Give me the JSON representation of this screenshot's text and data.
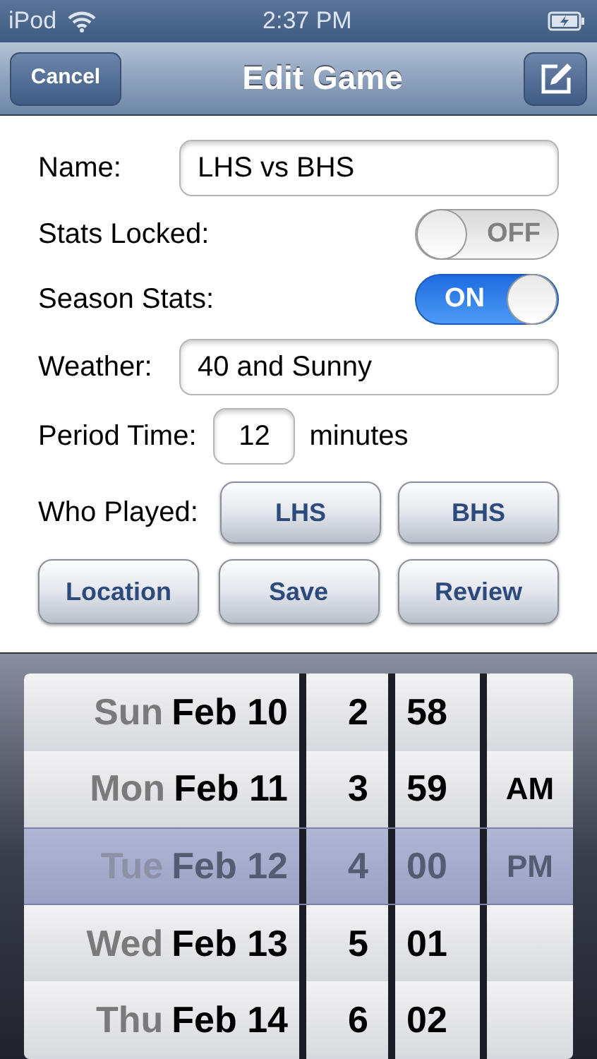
{
  "status_bar": {
    "carrier": "iPod",
    "time": "2:37 PM"
  },
  "nav_bar": {
    "title": "Edit Game",
    "cancel": "Cancel"
  },
  "fields": [
    {
      "kind": "text",
      "label": "Name:",
      "value": "LHS vs BHS"
    },
    {
      "kind": "switch",
      "label": "Stats Locked:",
      "on": false,
      "switch_text": "OFF"
    },
    {
      "kind": "switch",
      "label": "Season Stats:",
      "on": true,
      "switch_text": "ON"
    },
    {
      "kind": "text",
      "label": "Weather:",
      "value": "40 and Sunny"
    },
    {
      "kind": "number",
      "label": "Period Time:",
      "value": "12",
      "unit": "minutes"
    },
    {
      "kind": "buttons",
      "label": "Who Played:",
      "buttons": [
        "LHS",
        "BHS"
      ]
    }
  ],
  "actions": [
    "Location",
    "Save",
    "Review"
  ],
  "picker": {
    "rows": [
      {
        "day": "Sun",
        "date": "Feb 10",
        "hour": "2",
        "minute": "58",
        "ampm": "",
        "selected": false
      },
      {
        "day": "Mon",
        "date": "Feb 11",
        "hour": "3",
        "minute": "59",
        "ampm": "AM",
        "selected": false
      },
      {
        "day": "Tue",
        "date": "Feb 12",
        "hour": "4",
        "minute": "00",
        "ampm": "PM",
        "selected": true
      },
      {
        "day": "Wed",
        "date": "Feb 13",
        "hour": "5",
        "minute": "01",
        "ampm": "",
        "selected": false
      },
      {
        "day": "Thu",
        "date": "Feb 14",
        "hour": "6",
        "minute": "02",
        "ampm": "",
        "selected": false
      }
    ]
  }
}
